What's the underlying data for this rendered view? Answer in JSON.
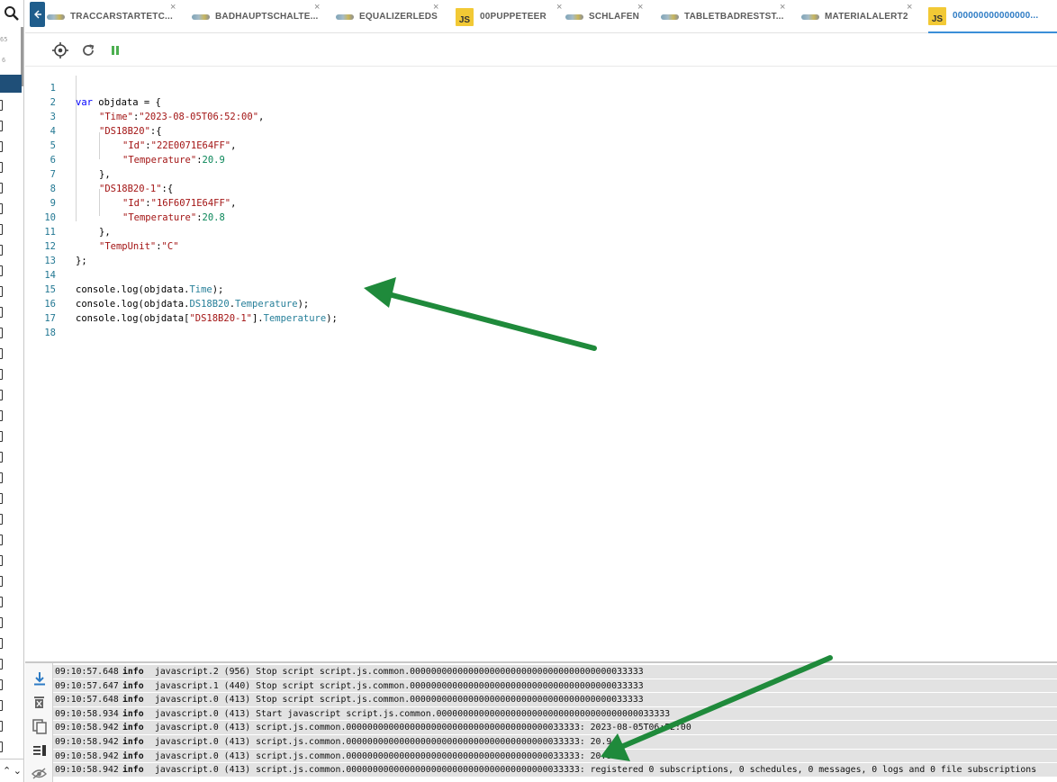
{
  "tabs": [
    {
      "label": "TRACCARSTARTETC...",
      "icon": "blockly-icon",
      "active": false
    },
    {
      "label": "BADHAUPTSCHALTE...",
      "icon": "blockly-icon",
      "active": false
    },
    {
      "label": "EQUALIZERLEDS",
      "icon": "blockly-icon",
      "active": false
    },
    {
      "label": "00PUPPETEER",
      "icon": "js-icon",
      "active": false
    },
    {
      "label": "SCHLAFEN",
      "icon": "blockly-icon",
      "active": false
    },
    {
      "label": "TABLETBADRESTST...",
      "icon": "blockly-icon",
      "active": false
    },
    {
      "label": "MATERIALALERT2",
      "icon": "blockly-icon",
      "active": false
    },
    {
      "label": "000000000000000...",
      "icon": "js-icon",
      "active": true
    }
  ],
  "js_icon_text": "JS",
  "close_glyph": "×",
  "sidebar": {
    "num_top": "65",
    "num_second": "6",
    "bottom_ctrl": "ᐱᐯ"
  },
  "editor": {
    "line_numbers": [
      "1",
      "2",
      "3",
      "4",
      "5",
      "6",
      "7",
      "8",
      "9",
      "10",
      "11",
      "12",
      "13",
      "14",
      "15",
      "16",
      "17",
      "18"
    ],
    "code": {
      "l1": {
        "kw": "var",
        "rest": " objdata = {"
      },
      "l2": {
        "key": "\"Time\"",
        "sep": ":",
        "val": "\"2023-08-05T06:52:00\"",
        "tail": ","
      },
      "l3": {
        "key": "\"DS18B20\"",
        "tail": ":{"
      },
      "l4": {
        "key": "\"Id\"",
        "sep": ":",
        "val": "\"22E0071E64FF\"",
        "tail": ","
      },
      "l5": {
        "key": "\"Temperature\"",
        "sep": ":",
        "num": "20.9"
      },
      "l6": {
        "text": "},"
      },
      "l7": {
        "key": "\"DS18B20-1\"",
        "tail": ":{"
      },
      "l8": {
        "key": "\"Id\"",
        "sep": ":",
        "val": "\"16F6071E64FF\"",
        "tail": ","
      },
      "l9": {
        "key": "\"Temperature\"",
        "sep": ":",
        "num": "20.8"
      },
      "l10": {
        "text": "},"
      },
      "l11": {
        "key": "\"TempUnit\"",
        "sep": ":",
        "val": "\"C\""
      },
      "l12": {
        "text": "};"
      },
      "l14": {
        "pre": "console.log(objdata.",
        "prop": "Time",
        "post": ");"
      },
      "l15": {
        "pre": "console.log(objdata.",
        "prop1": "DS18B20",
        "dot": ".",
        "prop2": "Temperature",
        "post": ");"
      },
      "l16": {
        "pre": "console.log(objdata[",
        "str": "\"DS18B20-1\"",
        "mid": "].",
        "prop": "Temperature",
        "post": ");"
      }
    }
  },
  "log": [
    {
      "time": "09:10:57.648",
      "severity": "info",
      "message": "javascript.2 (956) Stop script script.js.common.00000000000000000000000000000000000000033333"
    },
    {
      "time": "09:10:57.647",
      "severity": "info",
      "message": "javascript.1 (440) Stop script script.js.common.00000000000000000000000000000000000000033333"
    },
    {
      "time": "09:10:57.648",
      "severity": "info",
      "message": "javascript.0 (413) Stop script script.js.common.00000000000000000000000000000000000000033333"
    },
    {
      "time": "09:10:58.934",
      "severity": "info",
      "message": "javascript.0 (413) Start javascript script.js.common.00000000000000000000000000000000000000033333"
    },
    {
      "time": "09:10:58.942",
      "severity": "info",
      "message": "javascript.0 (413) script.js.common.00000000000000000000000000000000000000033333: 2023-08-05T06:52:00"
    },
    {
      "time": "09:10:58.942",
      "severity": "info",
      "message": "javascript.0 (413) script.js.common.00000000000000000000000000000000000000033333: 20.9"
    },
    {
      "time": "09:10:58.942",
      "severity": "info",
      "message": "javascript.0 (413) script.js.common.00000000000000000000000000000000000000033333: 20.8"
    },
    {
      "time": "09:10:58.942",
      "severity": "info",
      "message": "javascript.0 (413) script.js.common.00000000000000000000000000000000000000033333: registered 0 subscriptions, 0 schedules, 0 messages, 0 logs and 0 file subscriptions"
    }
  ],
  "colors": {
    "accent_blue": "#2d7bc4",
    "annotation_arrow": "#1f8a3b",
    "pause_green": "#4caf50",
    "log_row_bg": "#e2e2e2"
  }
}
